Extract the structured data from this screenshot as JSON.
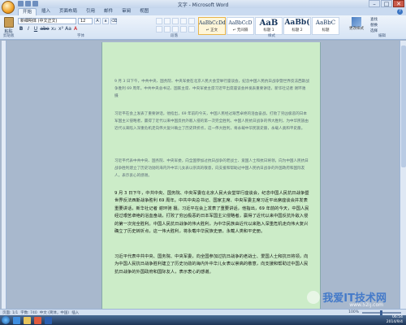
{
  "window": {
    "title": "文字 - Microsoft Word",
    "controls": [
      "–",
      "□",
      "✕"
    ]
  },
  "tabs": [
    "开始",
    "插入",
    "页面布局",
    "引用",
    "邮件",
    "审阅",
    "视图"
  ],
  "ribbon": {
    "paste_label": "粘贴",
    "font_name": "新细明体 (中文正文)",
    "font_size": "12",
    "format_buttons": [
      "B",
      "I",
      "U",
      "abe",
      "x₂",
      "x²",
      "Aa",
      "A"
    ],
    "groups": {
      "clipboard": "剪贴板",
      "font": "字体",
      "paragraph": "段落",
      "styles": "样式",
      "editing": "编辑"
    },
    "styles": [
      {
        "sample": "AaBbCcDd",
        "name": "↵ 正文",
        "selected": true
      },
      {
        "sample": "AaBbCcD",
        "name": "↵ 无间隔",
        "selected": false
      },
      {
        "sample": "AaB",
        "name": "标题 1",
        "selected": false
      },
      {
        "sample": "AaBb(",
        "name": "标题 2",
        "selected": false
      },
      {
        "sample": "AaBbC",
        "name": "标题",
        "selected": false
      }
    ],
    "change_styles": "更改样式",
    "edit_items": [
      "查找",
      "替换",
      "选择"
    ]
  },
  "document": {
    "paragraphs_faded": [
      "9 月 3 日下午，中共中央、国务院、中央军委在北京人民大会堂举行座谈会，纪念中国人民抗日战争暨世界反法西斯战争胜利 69 周年。中共中央总书记、国家主席、中央军委主席习近平出席座谈会并发表重要讲话，新华社记者 谢环驰 摄",
      "习近平在会上发表了重要讲话，他指出，69 年前的今天，中国人民经过艰苦卓绝的浴血奋战，打败了穷凶极恶的日本军国主义侵略者，赢得了近代以来中国反抗外敌入侵的第一次完全胜利。中国人民抗日战争的伟大胜利，为中华民族由近代以来陷入深重危机走向伟大复兴确立了历史转折点，这一伟大胜利，将永载中华民族史册，永载人类和平史册。",
      "习近平代表中共中央、国务院、中央军委，向全国参加过抗日战争的老战士、爱国人士和抗日将领，向为中国人民抗日战争胜利建立了历史功勋的海内外中华儿女表以崇高的敬意，向支援和帮助过中国人民抗日战争的外国政府和国际友人，表示衷心的感谢。"
    ],
    "paragraphs_bold": [
      "9 月 3 日下午，中共中央、国务院、中央军委在北京人民大会堂举行座谈会，纪念中国人民抗日战争暨世界反法西斯战争胜利 69 周年。中共中央总书记、国家主席、中央军委主席习近平出席座谈会并发表重要讲话，新华社记者 谢环驰 摄。习近平在会上发表了重要讲话，他指出，69 年前的今天，中国人民经过艰苦卓绝的浴血奋战，打败了穷凶极恶的日本军国主义侵略者，赢得了近代以来中国反抗外敌入侵的第一次完全胜利。中国人民抗日战争的伟大胜利，为中华民族由近代以来陷入深重危机走向伟大复兴确立了历史转折点，这一伟大胜利，将永载中华民族史册，永载人类和平史册。",
      "习近平代表中共中央、国务院、中央军委，向全国参加过抗日战争的老战士、爱国人士和抗日将领，向为中国人民抗日战争胜利建立了历史功勋的海内外中华儿女表以崇高的敬意，向支援和帮助过中国人民抗日战争的外国政府和国际友人，表示衷心的感谢。"
    ]
  },
  "statusbar": {
    "page": "页面: 1/1",
    "words": "字数: 740",
    "lang": "中文 (简体，中国)",
    "insert": "插入",
    "zoom": "100%"
  },
  "taskbar": {
    "time": "06:54",
    "date": "2014/9/4"
  },
  "watermark": {
    "text": "我爱IT技术网",
    "url": "www.52ij.com"
  }
}
